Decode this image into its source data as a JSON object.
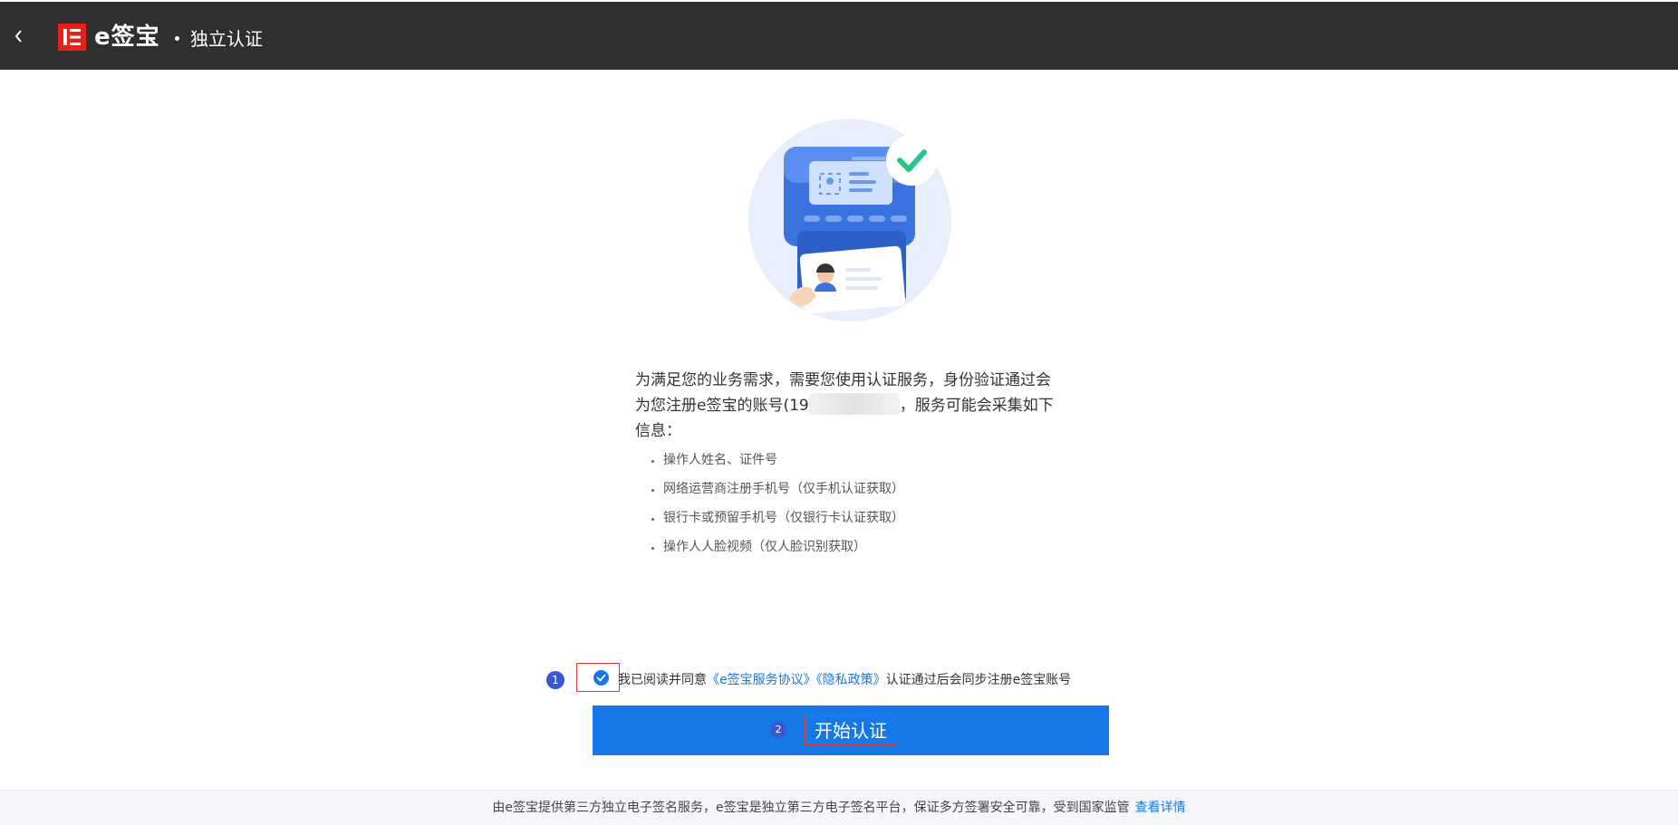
{
  "header": {
    "back_icon": "chevron-left-icon",
    "logo_text": "e签宝",
    "page_title": "独立认证"
  },
  "intro": {
    "line1": "为满足您的业务需求，需要您使用认证服务，身份验证通过会",
    "line2_before": "为您注册e签宝的账号(19",
    "line2_after": "，服务可能会采集如下",
    "line3": "信息："
  },
  "info_items": [
    "操作人姓名、证件号",
    "网络运营商注册手机号（仅手机认证获取）",
    "银行卡或预留手机号（仅银行卡认证获取）",
    "操作人人脸视频（仅人脸识别获取）"
  ],
  "agreement": {
    "step_number": "1",
    "prefix": "我已阅读并同意",
    "service_link": "《e签宝服务协议》",
    "privacy_link": "《隐私政策》",
    "suffix": "认证通过后会同步注册e签宝账号"
  },
  "start_button": {
    "step_number": "2",
    "label": "开始认证"
  },
  "footer": {
    "text": "由e签宝提供第三方独立电子签名服务，e签宝是独立第三方电子签名平台，保证多方签署安全可靠，受到国家监管",
    "link": "查看详情"
  },
  "colors": {
    "header_bg": "#2f2f2f",
    "brand_red": "#e8201a",
    "primary_blue": "#1677e6",
    "step_badge": "#3a56d6",
    "footer_bg": "#f4f6fa"
  }
}
